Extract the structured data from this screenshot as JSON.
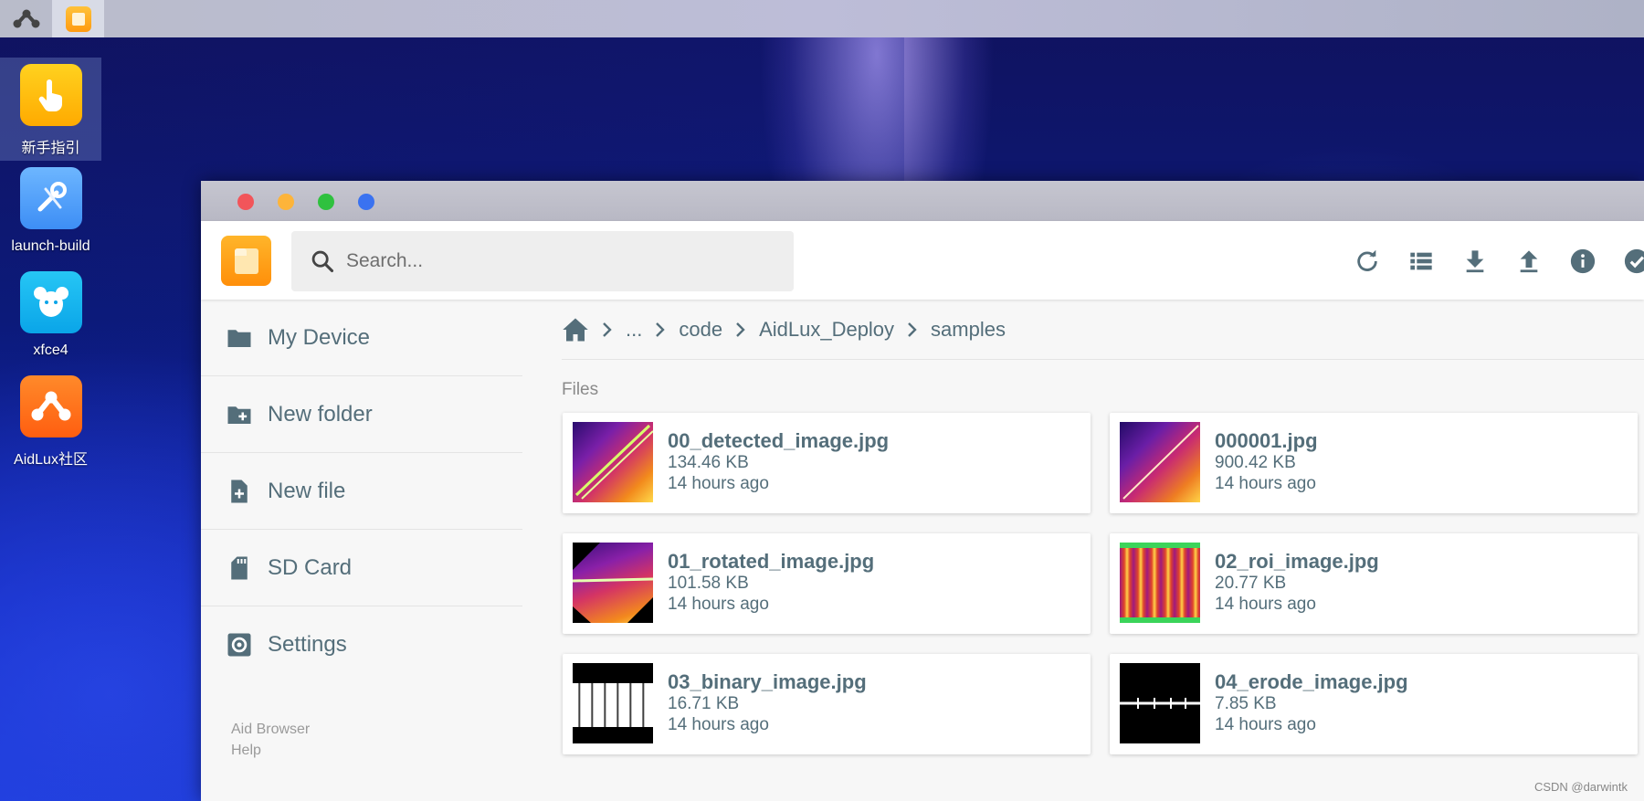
{
  "desktop": {
    "icons": [
      {
        "label": "新手指引",
        "icon": "hand-pointer-icon"
      },
      {
        "label": "launch-build",
        "icon": "wrench-pencil-icon"
      },
      {
        "label": "xfce4",
        "icon": "mouse-icon"
      },
      {
        "label": "AidLux社区",
        "icon": "aidlux-logo-icon"
      }
    ]
  },
  "taskbar": {
    "items": [
      {
        "icon": "aidlux-menu-icon"
      },
      {
        "icon": "files-app-icon"
      }
    ]
  },
  "window": {
    "traffic_lights": [
      "#f2555a",
      "#fdb43a",
      "#2fc13f",
      "#3a72f0"
    ],
    "search": {
      "placeholder": "Search..."
    },
    "toolbar": [
      "refresh-icon",
      "list-view-icon",
      "download-icon",
      "upload-icon",
      "info-icon",
      "select-check-icon"
    ],
    "sidebar": {
      "items": [
        {
          "label": "My Device",
          "icon": "folder-icon"
        },
        {
          "label": "New folder",
          "icon": "new-folder-icon"
        },
        {
          "label": "New file",
          "icon": "new-file-icon"
        },
        {
          "label": "SD Card",
          "icon": "sd-card-icon"
        },
        {
          "label": "Settings",
          "icon": "settings-icon"
        }
      ],
      "footer": {
        "line1": "Aid Browser",
        "line2": "Help"
      }
    },
    "breadcrumb": [
      "...",
      "code",
      "AidLux_Deploy",
      "samples"
    ],
    "files_label": "Files",
    "files": [
      {
        "name": "00_detected_image.jpg",
        "size": "134.46 KB",
        "modified": "14 hours ago"
      },
      {
        "name": "000001.jpg",
        "size": "900.42 KB",
        "modified": "14 hours ago"
      },
      {
        "name": "01_rotated_image.jpg",
        "size": "101.58 KB",
        "modified": "14 hours ago"
      },
      {
        "name": "02_roi_image.jpg",
        "size": "20.77 KB",
        "modified": "14 hours ago"
      },
      {
        "name": "03_binary_image.jpg",
        "size": "16.71 KB",
        "modified": "14 hours ago"
      },
      {
        "name": "04_erode_image.jpg",
        "size": "7.85 KB",
        "modified": "14 hours ago"
      }
    ]
  },
  "watermark": "CSDN @darwintk",
  "colors": {
    "accent": "#546e7a",
    "logo_orange": "#ff9b10"
  }
}
